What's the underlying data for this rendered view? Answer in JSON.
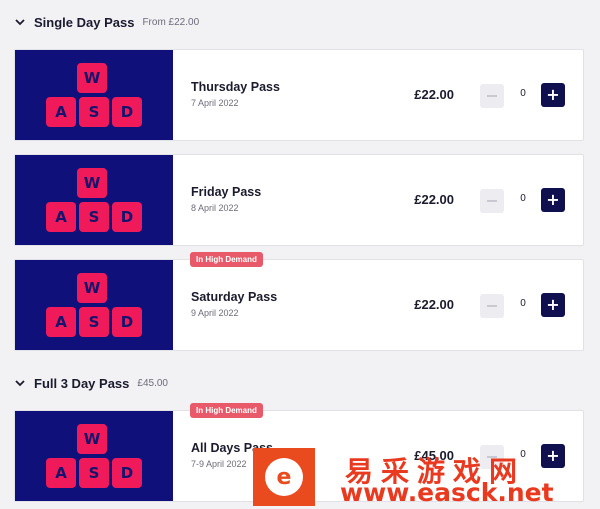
{
  "sections": [
    {
      "title": "Single Day Pass",
      "price_label": "From £22.00",
      "passes": [
        {
          "name": "Thursday Pass",
          "date": "7 April 2022",
          "price": "£22.00",
          "quantity": "0",
          "badge": ""
        },
        {
          "name": "Friday Pass",
          "date": "8 April 2022",
          "price": "£22.00",
          "quantity": "0",
          "badge": ""
        },
        {
          "name": "Saturday Pass",
          "date": "9 April 2022",
          "price": "£22.00",
          "quantity": "0",
          "badge": "In High Demand"
        }
      ]
    },
    {
      "title": "Full 3 Day Pass",
      "price_label": "£45.00",
      "passes": [
        {
          "name": "All Days Pass",
          "date": "7-9 April 2022",
          "price": "£45.00",
          "quantity": "0",
          "badge": "In High Demand"
        }
      ]
    }
  ],
  "thumbnail_keys": {
    "w": "W",
    "a": "A",
    "s": "S",
    "d": "D"
  },
  "controls": {
    "plus_symbol": "+",
    "minus_icon": "minus-icon",
    "chevron_icon": "chevron-down-icon"
  },
  "colors": {
    "thumbnail_bg": "#10107a",
    "key_bg": "#f0195a",
    "plus_button_bg": "#10104f",
    "badge_bg": "#e85a6a",
    "page_bg": "#f2f2f5"
  },
  "watermark": {
    "logo_glyph": "e",
    "chinese_text": "易采游戏网",
    "url": "www.easck.net"
  }
}
